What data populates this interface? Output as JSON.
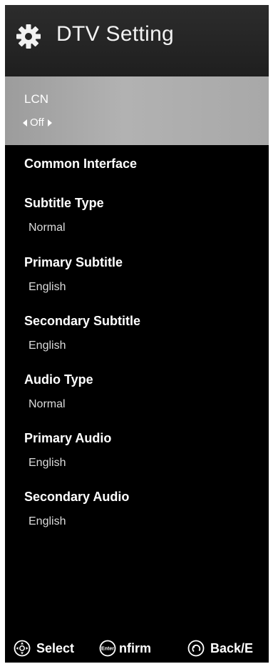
{
  "header": {
    "title": "DTV Setting",
    "icon": "gear-icon"
  },
  "menu": {
    "selected": {
      "label": "LCN",
      "value": "Off"
    },
    "items": [
      {
        "label": "Common Interface",
        "value": ""
      },
      {
        "label": "Subtitle Type",
        "value": "Normal"
      },
      {
        "label": "Primary Subtitle",
        "value": "English"
      },
      {
        "label": "Secondary Subtitle",
        "value": "English"
      },
      {
        "label": "Audio Type",
        "value": "Normal"
      },
      {
        "label": "Primary Audio",
        "value": "English"
      },
      {
        "label": "Secondary Audio",
        "value": "English"
      }
    ]
  },
  "footer": {
    "select": {
      "label": "Select",
      "icon": "dpad-icon"
    },
    "confirm": {
      "label": "nfirm",
      "icon": "enter-icon",
      "icon_text": "Enter"
    },
    "back": {
      "label": "Back/E",
      "icon": "back-icon"
    }
  }
}
